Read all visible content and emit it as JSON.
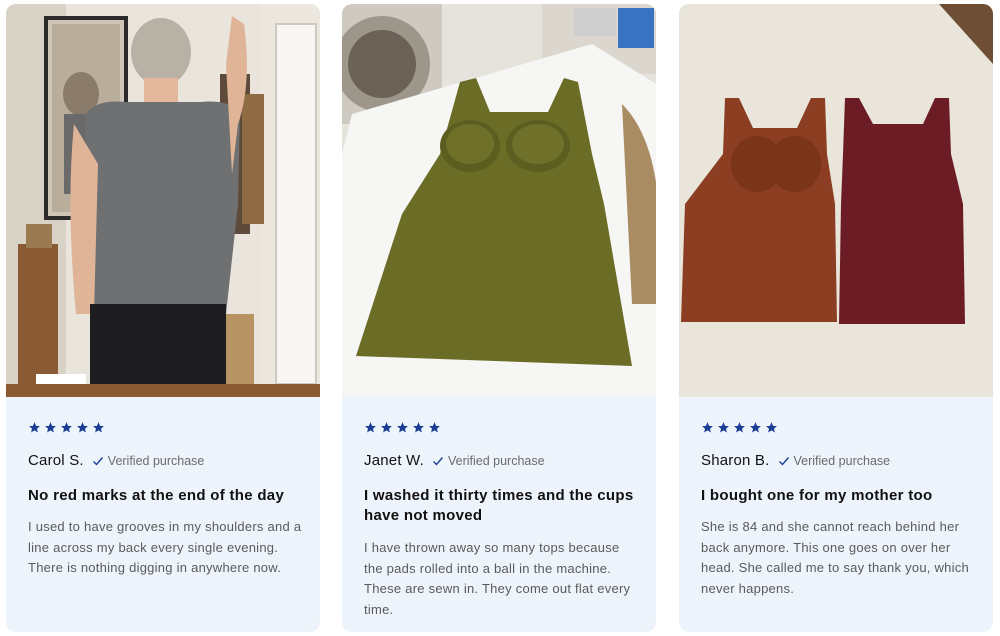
{
  "reviews": [
    {
      "rating": 5,
      "name": "Carol S.",
      "verified": "Verified purchase",
      "headline": "No red marks at the end of the day",
      "text": "I used to have grooves in my shoulders and a line across my back every single evening. There is nothing digging in anywhere now."
    },
    {
      "rating": 5,
      "name": "Janet W.",
      "verified": "Verified purchase",
      "headline": "I washed it thirty times and the cups have not moved",
      "text": "I have thrown away so many tops because the pads rolled into a ball in the machine. These are sewn in. They come out flat every time."
    },
    {
      "rating": 5,
      "name": "Sharon B.",
      "verified": "Verified purchase",
      "headline": "I bought one for my mother too",
      "text": "She is 84 and she cannot reach behind her back anymore. This one goes on over her head. She called me to say thank you, which never happens."
    }
  ],
  "colors": {
    "star": "#1b3f95",
    "card_bg": "#eef4fb",
    "verified_check": "#1b3f95"
  }
}
